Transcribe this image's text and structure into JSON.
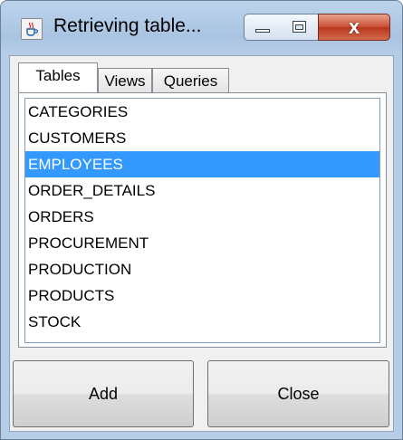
{
  "window": {
    "title": "Retrieving table...",
    "icon": "java-cup-icon",
    "close_glyph": "x",
    "accent_colors": {
      "selection": "#3399ff",
      "close_button": "#c94d33"
    }
  },
  "tabs": [
    {
      "label": "Tables",
      "active": true
    },
    {
      "label": "Views",
      "active": false
    },
    {
      "label": "Queries",
      "active": false
    }
  ],
  "tables": {
    "items": [
      {
        "label": "CATEGORIES",
        "selected": false
      },
      {
        "label": "CUSTOMERS",
        "selected": false
      },
      {
        "label": "EMPLOYEES",
        "selected": true
      },
      {
        "label": "ORDER_DETAILS",
        "selected": false
      },
      {
        "label": "ORDERS",
        "selected": false
      },
      {
        "label": "PROCUREMENT",
        "selected": false
      },
      {
        "label": "PRODUCTION",
        "selected": false
      },
      {
        "label": "PRODUCTS",
        "selected": false
      },
      {
        "label": "STOCK",
        "selected": false
      }
    ]
  },
  "buttons": {
    "add_label": "Add",
    "close_label": "Close"
  }
}
